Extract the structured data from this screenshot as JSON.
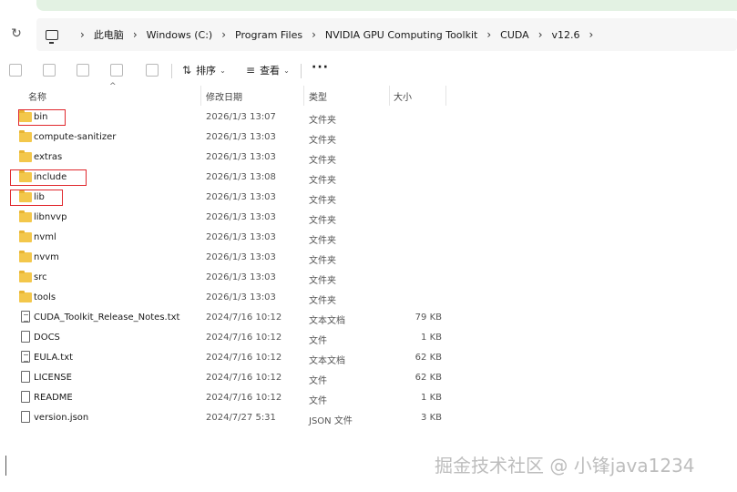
{
  "breadcrumb": [
    "此电脑",
    "Windows (C:)",
    "Program Files",
    "NVIDIA GPU Computing Toolkit",
    "CUDA",
    "v12.6"
  ],
  "toolbar": {
    "sort_label": "排序",
    "view_label": "查看",
    "more_label": "···"
  },
  "columns": {
    "name": "名称",
    "date": "修改日期",
    "type": "类型",
    "size": "大小"
  },
  "files": [
    {
      "name": "bin",
      "date": "2026/1/3 13:07",
      "type": "文件夹",
      "size": "",
      "kind": "folder",
      "highlighted": true
    },
    {
      "name": "compute-sanitizer",
      "date": "2026/1/3 13:03",
      "type": "文件夹",
      "size": "",
      "kind": "folder",
      "highlighted": false
    },
    {
      "name": "extras",
      "date": "2026/1/3 13:03",
      "type": "文件夹",
      "size": "",
      "kind": "folder",
      "highlighted": false
    },
    {
      "name": "include",
      "date": "2026/1/3 13:08",
      "type": "文件夹",
      "size": "",
      "kind": "folder",
      "highlighted": true
    },
    {
      "name": "lib",
      "date": "2026/1/3 13:03",
      "type": "文件夹",
      "size": "",
      "kind": "folder",
      "highlighted": true
    },
    {
      "name": "libnvvp",
      "date": "2026/1/3 13:03",
      "type": "文件夹",
      "size": "",
      "kind": "folder",
      "highlighted": false
    },
    {
      "name": "nvml",
      "date": "2026/1/3 13:03",
      "type": "文件夹",
      "size": "",
      "kind": "folder",
      "highlighted": false
    },
    {
      "name": "nvvm",
      "date": "2026/1/3 13:03",
      "type": "文件夹",
      "size": "",
      "kind": "folder",
      "highlighted": false
    },
    {
      "name": "src",
      "date": "2026/1/3 13:03",
      "type": "文件夹",
      "size": "",
      "kind": "folder",
      "highlighted": false
    },
    {
      "name": "tools",
      "date": "2026/1/3 13:03",
      "type": "文件夹",
      "size": "",
      "kind": "folder",
      "highlighted": false
    },
    {
      "name": "CUDA_Toolkit_Release_Notes.txt",
      "date": "2024/7/16 10:12",
      "type": "文本文档",
      "size": "79 KB",
      "kind": "text",
      "highlighted": false
    },
    {
      "name": "DOCS",
      "date": "2024/7/16 10:12",
      "type": "文件",
      "size": "1 KB",
      "kind": "file",
      "highlighted": false
    },
    {
      "name": "EULA.txt",
      "date": "2024/7/16 10:12",
      "type": "文本文档",
      "size": "62 KB",
      "kind": "text",
      "highlighted": false
    },
    {
      "name": "LICENSE",
      "date": "2024/7/16 10:12",
      "type": "文件",
      "size": "62 KB",
      "kind": "file",
      "highlighted": false
    },
    {
      "name": "README",
      "date": "2024/7/16 10:12",
      "type": "文件",
      "size": "1 KB",
      "kind": "file",
      "highlighted": false
    },
    {
      "name": "version.json",
      "date": "2024/7/27 5:31",
      "type": "JSON 文件",
      "size": "3 KB",
      "kind": "file",
      "highlighted": false
    }
  ],
  "watermark": "掘金技术社区 @ 小锋java1234",
  "colors": {
    "folder": "#f3c74b",
    "highlight_box": "#e0282d",
    "address_bg": "#f6f6f6"
  }
}
